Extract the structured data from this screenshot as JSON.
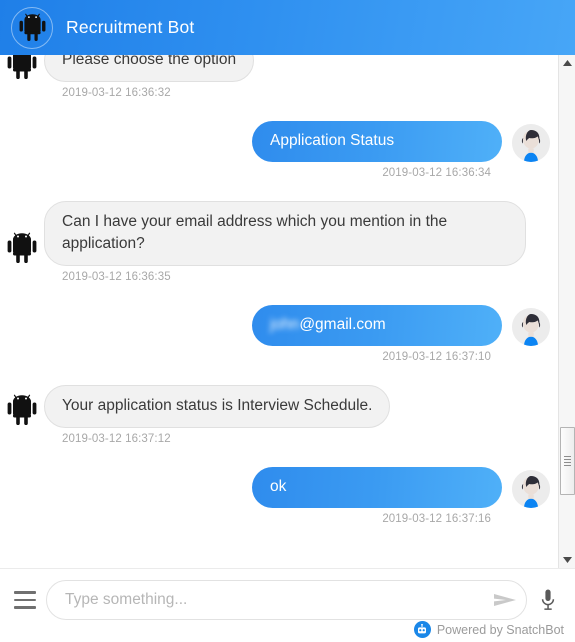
{
  "header": {
    "title": "Recruitment Bot",
    "avatar_icon": "android-robot-icon"
  },
  "messages": [
    {
      "sender": "bot",
      "text": "Please choose the option",
      "timestamp": "2019-03-12 16:36:32"
    },
    {
      "sender": "user",
      "text": "Application Status",
      "timestamp": "2019-03-12 16:36:34"
    },
    {
      "sender": "bot",
      "text": "Can I have your email address which you mention in the application?",
      "timestamp": "2019-03-12 16:36:35"
    },
    {
      "sender": "user",
      "text_blurred": "john",
      "text": "@gmail.com",
      "timestamp": "2019-03-12 16:37:10"
    },
    {
      "sender": "bot",
      "text": "Your application status is Interview Schedule.",
      "timestamp": "2019-03-12 16:37:12"
    },
    {
      "sender": "user",
      "text": "ok",
      "timestamp": "2019-03-12 16:37:16"
    }
  ],
  "composer": {
    "placeholder": "Type something...",
    "value": "",
    "menu_icon": "hamburger-menu-icon",
    "send_icon": "send-arrow-icon",
    "mic_icon": "microphone-icon"
  },
  "footer": {
    "powered_by": "Powered by SnatchBot",
    "logo_icon": "snatchbot-logo-icon"
  },
  "scrollbar": {
    "up_icon": "scroll-up-arrow-icon",
    "down_icon": "scroll-down-arrow-icon"
  },
  "colors": {
    "header_blue": "#2f90f0",
    "user_bubble_blue": "#3b9bf2",
    "bot_bubble_gray": "#f2f2f2",
    "timestamp_gray": "#a8a8a8"
  }
}
